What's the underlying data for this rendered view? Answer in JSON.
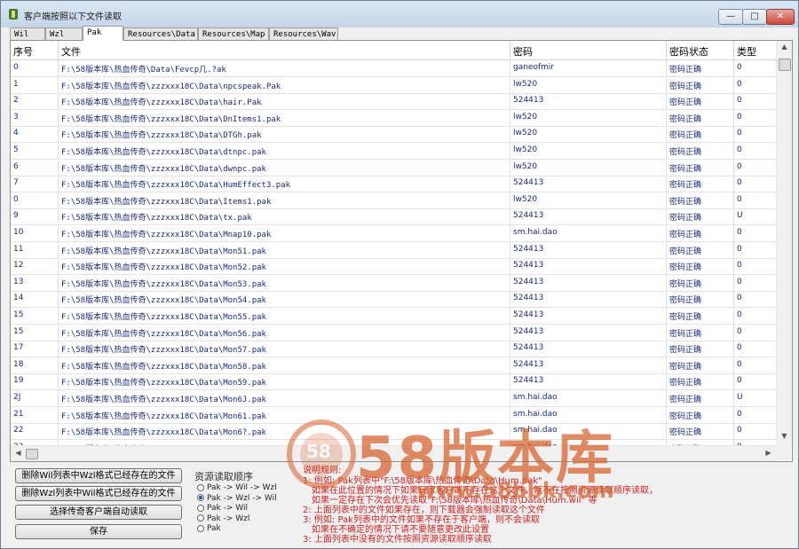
{
  "window": {
    "title": "客户端按照以下文件读取"
  },
  "tabs": [
    {
      "label": "Wil"
    },
    {
      "label": "Wzl"
    },
    {
      "label": "Pak",
      "active": true
    },
    {
      "label": "Resources\\Data"
    },
    {
      "label": "Resources\\Map"
    },
    {
      "label": "Resources\\Wav"
    }
  ],
  "table": {
    "headers": {
      "index": "序号",
      "file": "文件",
      "password": "密码",
      "status": "密码状态",
      "type": "类型"
    },
    "rows": [
      {
        "index": "0",
        "file": "F:\\58版本库\\热血传奇\\Data\\Fevcp几.?ak",
        "password": "ganeofmir",
        "status": "密码正确",
        "type": "0"
      },
      {
        "index": "1",
        "file": "F:\\58版本库\\热血传奇\\zzzxxx18C\\Data\\npcspeak.Pak",
        "password": "lw520",
        "status": "密码正确",
        "type": "0"
      },
      {
        "index": "2",
        "file": "F:\\58版本库\\热血传奇\\zzzxxx18C\\Data\\hair.Pak",
        "password": "524413",
        "status": "密码正确",
        "type": "0"
      },
      {
        "index": "3",
        "file": "F:\\58版本库\\热血传奇\\zzzxxx18C\\Data\\DnItems1.pak",
        "password": "lw520",
        "status": "密码正确",
        "type": "0"
      },
      {
        "index": "4",
        "file": "F:\\58版本库\\热血传奇\\zzzxxx18C\\Data\\DTGh.pak",
        "password": "lw520",
        "status": "密码正确",
        "type": "0"
      },
      {
        "index": "5",
        "file": "F:\\58版本库\\热血传奇\\zzzxxx18C\\Data\\dtnpc.pak",
        "password": "lw520",
        "status": "密码正确",
        "type": "0"
      },
      {
        "index": "6",
        "file": "F:\\58版本库\\热血传奇\\zzzxxx18C\\Data\\dwnpc.pak",
        "password": "lw520",
        "status": "密码正确",
        "type": "0"
      },
      {
        "index": "7",
        "file": "F:\\58版本库\\热血传奇\\zzzxxx18C\\Data\\HumEffect3.pak",
        "password": "524413",
        "status": "密码正确",
        "type": "0"
      },
      {
        "index": "0",
        "file": "F:\\58版本库\\热血传奇\\zzzxxx18C\\Data\\Items1.pak",
        "password": "lw520",
        "status": "密码正确",
        "type": "0"
      },
      {
        "index": "9",
        "file": "F:\\58版本库\\热血传奇\\zzzxxx18C\\Data\\tx.pak",
        "password": "524413",
        "status": "密码正确",
        "type": "U"
      },
      {
        "index": "10",
        "file": "F:\\58版本库\\热血传奇\\zzzxxx18C\\Data\\Mnap10.pak",
        "password": "sm.hai.dao",
        "status": "密码正确",
        "type": "0"
      },
      {
        "index": "11",
        "file": "F:\\58版本库\\热血传奇\\zzzxxx18C\\Data\\Mon51.pak",
        "password": "524413",
        "status": "密码正确",
        "type": "0"
      },
      {
        "index": "12",
        "file": "F:\\58版本库\\热血传奇\\zzzxxx18C\\Data\\Mon52.pak",
        "password": "524413",
        "status": "密码正确",
        "type": "0"
      },
      {
        "index": "13",
        "file": "F:\\58版本库\\热血传奇\\zzzxxx18C\\Data\\Mon53.pak",
        "password": "524413",
        "status": "密码正确",
        "type": "0"
      },
      {
        "index": "14",
        "file": "F:\\58版本库\\热血传奇\\zzzxxx18C\\Data\\Mon54.pak",
        "password": "524413",
        "status": "密码正确",
        "type": "0"
      },
      {
        "index": "15",
        "file": "F:\\58版本库\\热血传奇\\zzzxxx18C\\Data\\Mon55.pak",
        "password": "524413",
        "status": "密码正确",
        "type": "0"
      },
      {
        "index": "15",
        "file": "F:\\58版本库\\热血传奇\\zzzxxx18C\\Data\\Mon56.pak",
        "password": "524413",
        "status": "密码正确",
        "type": "0"
      },
      {
        "index": "17",
        "file": "F:\\58版本库\\热血传奇\\zzzxxx18C\\Data\\Mon57.pak",
        "password": "524413",
        "status": "密码正确",
        "type": "0"
      },
      {
        "index": "18",
        "file": "F:\\58版本库\\热血传奇\\zzzxxx18C\\Data\\Mon58.pak",
        "password": "524413",
        "status": "密码正确",
        "type": "0"
      },
      {
        "index": "19",
        "file": "F:\\58版本库\\热血传奇\\zzzxxx18C\\Data\\Mon59.pak",
        "password": "524413",
        "status": "密码正确",
        "type": "0"
      },
      {
        "index": "2J",
        "file": "F:\\58版本库\\热血传奇\\zzzxxx18C\\Data\\Mon6J.pak",
        "password": "sm.hai.dao",
        "status": "密码正确",
        "type": "U"
      },
      {
        "index": "21",
        "file": "F:\\58版本库\\热血传奇\\zzzxxx18C\\Data\\Mon61.pak",
        "password": "sm.hai.dao",
        "status": "密码正确",
        "type": "0"
      },
      {
        "index": "22",
        "file": "F:\\58版本库\\热血传奇\\zzzxxx18C\\Data\\Mon6?.pak",
        "password": "sm.hai.dao",
        "status": "密码正确",
        "type": "0"
      },
      {
        "index": "23",
        "file": "F:\\58版本库\\热血传奇\\zzzxxx18C\\Data\\Mon63.pak",
        "password": "sm.hai.dao",
        "status": "密码正确",
        "type": "0"
      }
    ]
  },
  "buttons": {
    "delete_wil": "删除Wil列表中Wzl格式已经存在的文件",
    "delete_wzl": "删除Wzl列表中Wil格式已经存在的文件",
    "auto_select": "选择传奇客户端自动读取",
    "save": "保存"
  },
  "order_group": {
    "title": "资源读取顺序",
    "options": [
      {
        "label": "Pak -> Wil -> Wzl",
        "checked": false
      },
      {
        "label": "Pak -> Wzl -> Wil",
        "checked": true
      },
      {
        "label": "Pak -> Wil",
        "checked": false
      },
      {
        "label": "Pak -> Wzl",
        "checked": false
      },
      {
        "label": "Pak",
        "checked": false
      }
    ]
  },
  "notes": {
    "heading": "说明规则:",
    "lines": [
      "1: 例如: Pak列表中\"F:\\58版本库\\热血传奇\\Data\\Hum.pak\"",
      "如果在此位置的情况下如果玩家客户端不存在这个文件，就不在按照资源读取顺序读取，",
      "如果一定存在下次会优先读取\"F:\\58版本库\\热血传奇\\Data\\Hum.wil\" 等",
      "2: 上面列表中的文件如果存在，则下载器会强制读取这个文件",
      "3: 例如: Pak列表中的文件如果不存在于客户端，则不会读取",
      "如果在不确定的情况下请不要随意更改此设置",
      "3: 上面列表中没有的文件按照资源读取顺序读取"
    ]
  },
  "watermark": {
    "text": "58版本库",
    "url": "www.58bbk.com",
    "badge": "58"
  },
  "colors": {
    "link_text": "#1a2a7a",
    "note_red": "#d02020",
    "watermark": "#d66028"
  }
}
